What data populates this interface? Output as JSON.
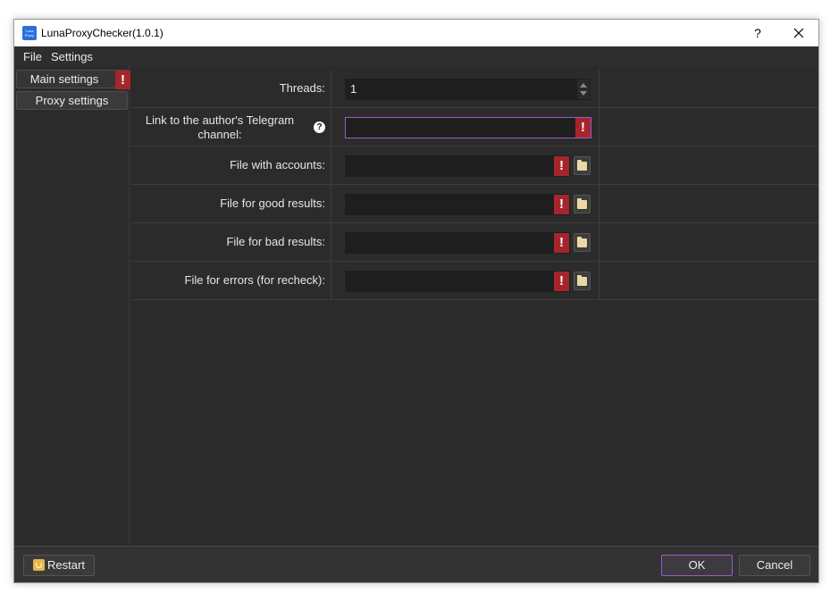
{
  "window": {
    "title": "LunaProxyChecker(1.0.1)",
    "icon_text": "Luna Proxy",
    "help_glyph": "?",
    "icons": {
      "app": "app-logo-icon",
      "close": "close-icon"
    }
  },
  "menu": {
    "items": [
      "File",
      "Settings"
    ]
  },
  "sidebar": {
    "items": [
      {
        "label": "Main settings",
        "warning": "!"
      },
      {
        "label": "Proxy settings"
      }
    ]
  },
  "form": {
    "rows": [
      {
        "label": "Threads:",
        "value": "1",
        "type": "spin"
      },
      {
        "label": "Link to the author's Telegram channel:",
        "value": "",
        "type": "text",
        "warning": "!",
        "help": "?"
      },
      {
        "label": "File with accounts:",
        "value": "",
        "type": "file",
        "warning": "!"
      },
      {
        "label": "File for good results:",
        "value": "",
        "type": "file",
        "warning": "!"
      },
      {
        "label": "File for bad results:",
        "value": "",
        "type": "file",
        "warning": "!"
      },
      {
        "label": "File for errors (for recheck):",
        "value": "",
        "type": "file",
        "warning": "!"
      }
    ]
  },
  "footer": {
    "restart_label": "Restart",
    "ok_label": "OK",
    "cancel_label": "Cancel"
  },
  "colors": {
    "background": "#2b2b2b",
    "warning": "#a4262c",
    "accent": "#9b59c9",
    "folder": "#e9d9a4"
  }
}
